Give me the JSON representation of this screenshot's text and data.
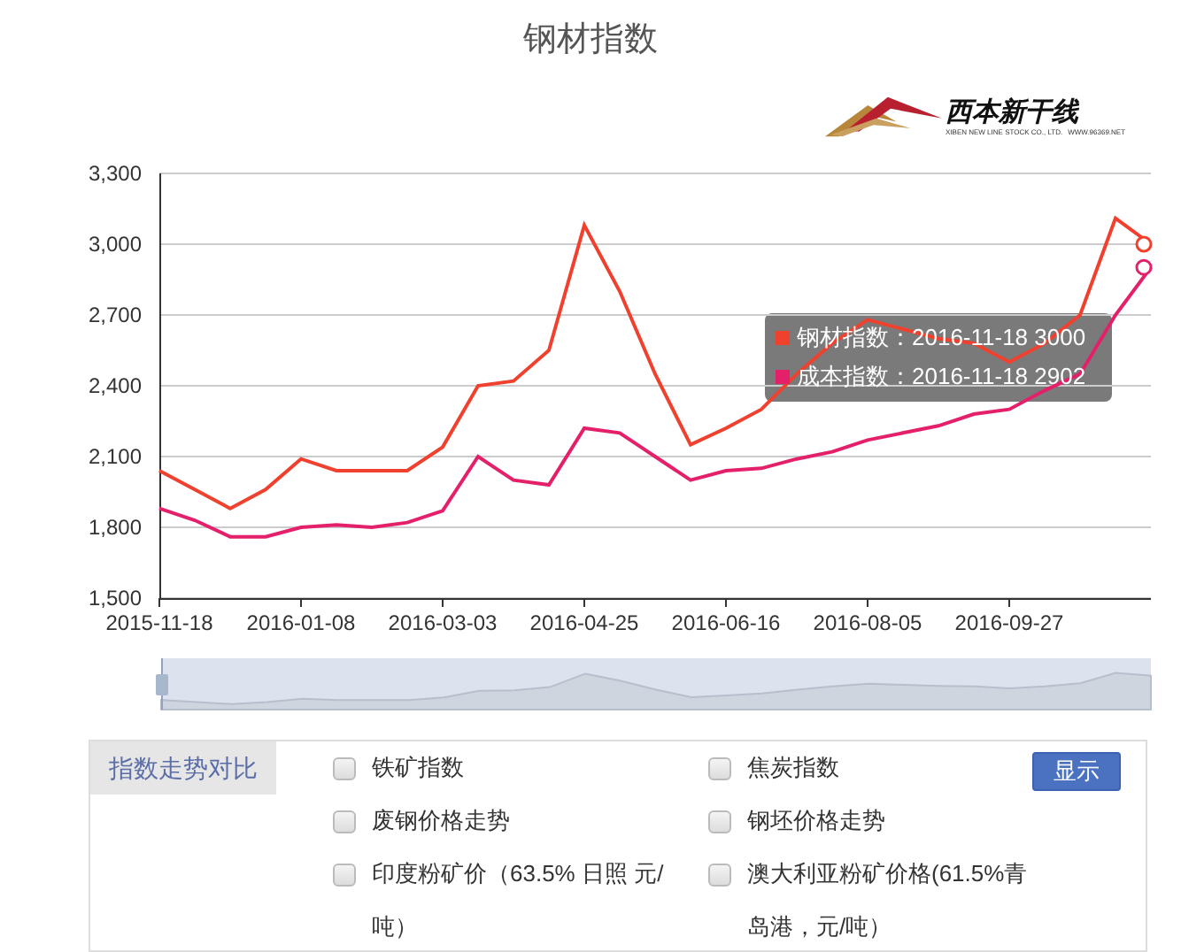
{
  "title": "钢材指数",
  "logo": {
    "name": "西本新干线",
    "subtitle": "XIBEN NEW LINE STOCK CO., LTD.",
    "url": "WWW.96369.NET"
  },
  "chart": {
    "chart_data": {
      "type": "line",
      "ylim": [
        1500,
        3300
      ],
      "yticks": [
        {
          "value": 1500,
          "label": "1,500"
        },
        {
          "value": 1800,
          "label": "1,800"
        },
        {
          "value": 2100,
          "label": "2,100"
        },
        {
          "value": 2400,
          "label": "2,400"
        },
        {
          "value": 2700,
          "label": "2,700"
        },
        {
          "value": 3000,
          "label": "3,000"
        },
        {
          "value": 3300,
          "label": "3,300"
        }
      ],
      "grid": true,
      "categories": [
        "2015-11-18",
        null,
        null,
        null,
        "2016-01-08",
        null,
        null,
        null,
        "2016-03-03",
        null,
        null,
        null,
        "2016-04-25",
        null,
        null,
        null,
        "2016-06-16",
        null,
        null,
        null,
        "2016-08-05",
        null,
        null,
        null,
        "2016-09-27",
        null,
        null,
        null,
        null
      ],
      "series": [
        {
          "color": "#f0412f",
          "values": [
            2040,
            1960,
            1880,
            1960,
            2090,
            2040,
            2040,
            2040,
            2140,
            2400,
            2420,
            2550,
            3080,
            2800,
            2450,
            2150,
            2220,
            2300,
            2450,
            2580,
            2680,
            2640,
            2600,
            2580,
            2500,
            2580,
            2700,
            3110,
            3000
          ]
        },
        {
          "color": "#e5206a",
          "values": [
            1880,
            1830,
            1760,
            1760,
            1800,
            1810,
            1800,
            1820,
            1870,
            2100,
            2000,
            1980,
            2220,
            2200,
            2100,
            2000,
            2040,
            2050,
            2090,
            2120,
            2170,
            2200,
            2230,
            2280,
            2300,
            2380,
            2450,
            2700,
            2902
          ]
        }
      ]
    }
  },
  "tooltip": {
    "items": [
      {
        "text": "钢材指数：2016-11-18 3000",
        "color": "#f0412f"
      },
      {
        "text": "成本指数：2016-11-18 2902",
        "color": "#e5206a"
      }
    ]
  },
  "panel": {
    "label": "指数走势对比",
    "options": [
      {
        "label": "铁矿指数",
        "checked": false
      },
      {
        "label": "焦炭指数",
        "checked": false
      },
      {
        "label": "废钢价格走势",
        "checked": false
      },
      {
        "label": "钢坯价格走势",
        "checked": false
      },
      {
        "label": "印度粉矿价（63.5% 日照 元/吨）",
        "checked": false
      },
      {
        "label": "澳大利亚粉矿价格(61.5%青岛港，元/吨）",
        "checked": false
      }
    ],
    "button": "显示"
  }
}
